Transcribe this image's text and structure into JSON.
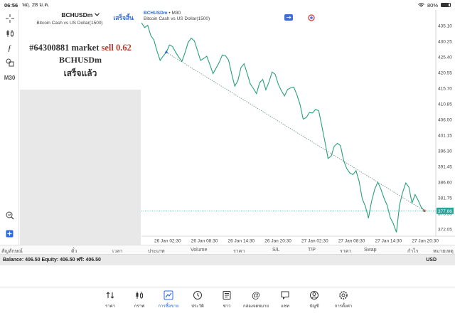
{
  "status": {
    "time": "06:56",
    "date": "พฤ. 28 ม.ค.",
    "battery": "80%",
    "battery_level": 0.8
  },
  "toolbar": {
    "tools": [
      "crosshair-icon",
      "candles-icon",
      "function-icon",
      "objects-icon"
    ],
    "timeframe": "M30"
  },
  "trade_panel": {
    "symbol": "BCHUSDm",
    "description": "Bitcoin Cash vs US Dollar(1500)",
    "done_label": "เสร็จสิ้น",
    "order_prefix": "#64300881 market",
    "order_action": "sell 0.62",
    "order_symbol": "BCHUSDm",
    "order_status": "เสร็จแล้ว"
  },
  "chart": {
    "symbol": "BCHUSDm",
    "separator": " • ",
    "timeframe": "M30",
    "description": "Bitcoin Cash vs US Dollar(1500)",
    "colors": {
      "line": "#27a07a",
      "dotted": "#6a8a80",
      "current_price_bg": "#26a69a",
      "accent": "#2a6ae5"
    }
  },
  "chart_data": {
    "type": "line",
    "title": "BCHUSDm • M30",
    "y_ticks": [
      "435.10",
      "430.25",
      "425.40",
      "420.55",
      "415.70",
      "410.85",
      "406.00",
      "401.15",
      "396.30",
      "391.45",
      "386.60",
      "381.75",
      "376.90",
      "372.05"
    ],
    "ylim": [
      369.8,
      437.3
    ],
    "x_ticks": [
      "26 Jan 02:30",
      "26 Jan 08:30",
      "26 Jan 14:30",
      "26 Jan 20:30",
      "27 Jan 02:30",
      "27 Jan 08:30",
      "27 Jan 14:30",
      "27 Jan 20:30"
    ],
    "current_price": "377.66",
    "current_price_value": 377.66,
    "series": [
      {
        "values": [
          436.0,
          434.5,
          435.2,
          432.0,
          430.6,
          427.2,
          424.3,
          425.7,
          426.8,
          429.1,
          428.6,
          426.8,
          425.3,
          424.0,
          426.7,
          429.9,
          431.2,
          430.4,
          427.4,
          424.3,
          424.9,
          425.6,
          423.0,
          420.2,
          421.9,
          423.7,
          426.0,
          425.8,
          424.4,
          420.2,
          416.3,
          418.0,
          422.1,
          423.3,
          420.2,
          417.0,
          415.6,
          414.0,
          417.4,
          418.4,
          415.2,
          417.6,
          420.7,
          420.0,
          416.9,
          414.9,
          413.3,
          415.3,
          415.8,
          416.0,
          413.6,
          410.6,
          406.1,
          406.6,
          408.1,
          408.0,
          409.1,
          408.7,
          404.0,
          399.1,
          393.9,
          394.6,
          397.7,
          398.6,
          397.9,
          393.3,
          390.8,
          389.4,
          388.9,
          390.1,
          386.8,
          381.4,
          379.1,
          375.4,
          380.6,
          384.3,
          386.6,
          384.4,
          381.6,
          379.4,
          375.6,
          373.7,
          371.0,
          379.5,
          383.4,
          386.3,
          385.0,
          380.1,
          382.7,
          380.9,
          378.7,
          377.7
        ]
      }
    ],
    "trade_line": {
      "from": 426.8,
      "to": 377.66
    }
  },
  "table_header": {
    "columns": [
      "สัญลักษณ์",
      "ตั๋ว",
      "เวลา",
      "ประเภท",
      "Volume",
      "ราคา",
      "S/L",
      "T/P",
      "ราคา",
      "Swap",
      "กำไร",
      "หมายเหตุ"
    ]
  },
  "balance": {
    "text": "Balance: 406.50  Equity: 406.50  ฟรี: 406.50",
    "currency": "USD"
  },
  "nav": {
    "items": [
      {
        "label": "ราคา",
        "icon": "quotes-icon"
      },
      {
        "label": "กราฟ",
        "icon": "chart-icon"
      },
      {
        "label": "การซื้อขาย",
        "icon": "trade-icon",
        "active": true
      },
      {
        "label": "ประวัติ",
        "icon": "history-icon"
      },
      {
        "label": "ข่าว",
        "icon": "news-icon"
      },
      {
        "label": "กล่องจดหมาย",
        "icon": "mailbox-icon"
      },
      {
        "label": "แชท",
        "icon": "chat-icon"
      },
      {
        "label": "บัญชี",
        "icon": "account-icon"
      },
      {
        "label": "การตั้งค่า",
        "icon": "settings-icon"
      }
    ]
  }
}
